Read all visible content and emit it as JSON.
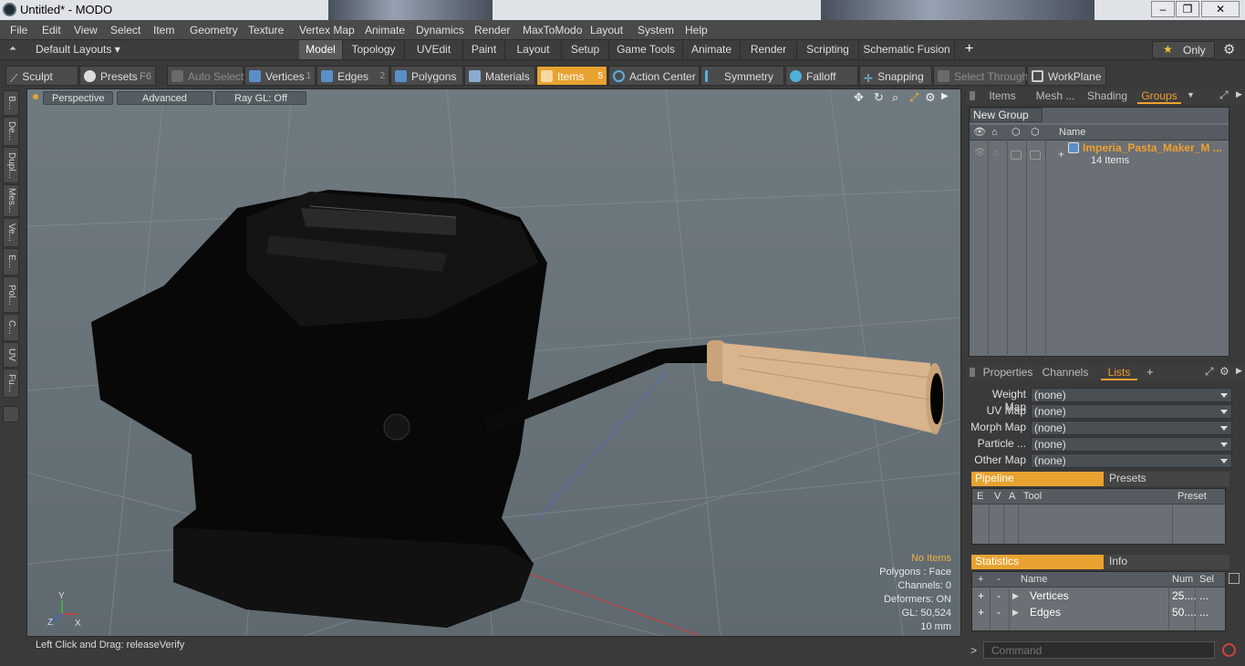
{
  "window": {
    "title": "Untitled* - MODO",
    "minimize": "‒",
    "maximize": "❐",
    "close": "✕"
  },
  "menu": [
    "File",
    "Edit",
    "View",
    "Select",
    "Item",
    "Geometry",
    "Texture",
    "Vertex Map",
    "Animate",
    "Dynamics",
    "Render",
    "MaxToModo",
    "Layout",
    "System",
    "Help"
  ],
  "layoutbar": {
    "layouts_label": "Default Layouts ▾",
    "tabs": [
      "Model",
      "Topology",
      "UVEdit",
      "Paint",
      "Layout",
      "Setup",
      "Game Tools",
      "Animate",
      "Render",
      "Scripting",
      "Schematic Fusion"
    ],
    "active_tab": "Model",
    "add": "+",
    "only_label": "Only",
    "star": "★"
  },
  "toolbar": {
    "sculpt": "Sculpt",
    "presets": "Presets",
    "presets_key": "F6",
    "auto_select": "Auto Select",
    "vertices": "Vertices",
    "vertices_num": "1",
    "edges": "Edges",
    "edges_num": "2",
    "polygons": "Polygons",
    "materials": "Materials",
    "items": "Items",
    "items_num": "5",
    "action_center": "Action Center",
    "symmetry": "Symmetry",
    "falloff": "Falloff",
    "snapping": "Snapping",
    "select_through": "Select Through",
    "workplane": "WorkPlane"
  },
  "lefttabs": [
    "B...",
    "De...",
    "Dupl...",
    "Mes...",
    "Ve...",
    "E...",
    "Pol...",
    "C...",
    "UV",
    "Fu..."
  ],
  "viewport": {
    "perspective": "Perspective",
    "advanced": "Advanced",
    "raygl": "Ray GL: Off",
    "hud": {
      "no_items": "No Items",
      "polygons": "Polygons : Face",
      "channels": "Channels: 0",
      "deformers": "Deformers: ON",
      "gl": "GL: 50,524",
      "scale": "10 mm"
    }
  },
  "statusbar": {
    "text": "Left Click and Drag:   releaseVerify"
  },
  "items_panel": {
    "tabs": [
      "Items",
      "Mesh ...",
      "Shading",
      "Groups"
    ],
    "active_tab": "Groups",
    "new_group": "New Group",
    "col_name": "Name",
    "group_name": "Imperia_Pasta_Maker_M ...",
    "group_count": "14 Items"
  },
  "props_panel": {
    "tabs": [
      "Properties",
      "Channels",
      "Lists"
    ],
    "active_tab": "Lists",
    "add": "+",
    "maps": [
      {
        "label": "Weight Map",
        "value": "(none)"
      },
      {
        "label": "UV Map",
        "value": "(none)"
      },
      {
        "label": "Morph Map",
        "value": "(none)"
      },
      {
        "label": "Particle ...",
        "value": "(none)"
      },
      {
        "label": "Other Map",
        "value": "(none)"
      }
    ],
    "pipeline": "Pipeline",
    "presets": "Presets",
    "pipe_cols": [
      "E",
      "V",
      "A",
      "Tool",
      "Preset"
    ],
    "statistics": "Statistics",
    "info": "Info",
    "stat_cols": [
      "+",
      "-",
      "Name",
      "Num",
      "Sel"
    ],
    "stat_rows": [
      {
        "plus": "+",
        "minus": "-",
        "name": "Vertices",
        "num": "25....",
        "sel": "..."
      },
      {
        "plus": "+",
        "minus": "-",
        "name": "Edges",
        "num": "50....",
        "sel": "..."
      }
    ]
  },
  "command": {
    "prompt": ">",
    "placeholder": "Command"
  },
  "colors": {
    "accent": "#e8a230",
    "viewport_bg": "#6a757b",
    "handle_wood": "#d9b48c"
  }
}
